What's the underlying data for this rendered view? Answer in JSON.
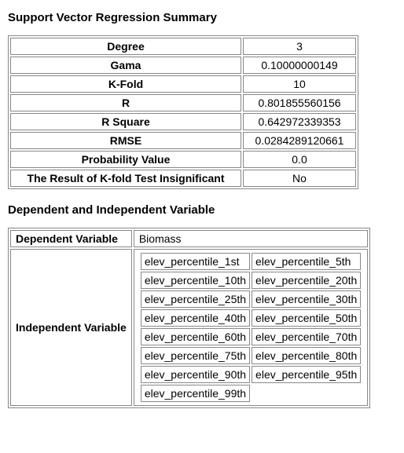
{
  "summary": {
    "title": "Support Vector Regression Summary",
    "rows": [
      {
        "label": "Degree",
        "value": "3"
      },
      {
        "label": "Gama",
        "value": "0.10000000149"
      },
      {
        "label": "K-Fold",
        "value": "10"
      },
      {
        "label": "R",
        "value": "0.801855560156"
      },
      {
        "label": "R Square",
        "value": "0.642972339353"
      },
      {
        "label": "RMSE",
        "value": "0.0284289120661"
      },
      {
        "label": "Probability Value",
        "value": "0.0"
      },
      {
        "label": "The Result of K-fold Test Insignificant",
        "value": "No"
      }
    ]
  },
  "variables": {
    "title": "Dependent and Independent Variable",
    "dependent_label": "Dependent Variable",
    "dependent_value": "Biomass",
    "independent_label": "Independent Variable",
    "independent_values": [
      "elev_percentile_1st",
      "elev_percentile_5th",
      "elev_percentile_10th",
      "elev_percentile_20th",
      "elev_percentile_25th",
      "elev_percentile_30th",
      "elev_percentile_40th",
      "elev_percentile_50th",
      "elev_percentile_60th",
      "elev_percentile_70th",
      "elev_percentile_75th",
      "elev_percentile_80th",
      "elev_percentile_90th",
      "elev_percentile_95th",
      "elev_percentile_99th"
    ]
  }
}
